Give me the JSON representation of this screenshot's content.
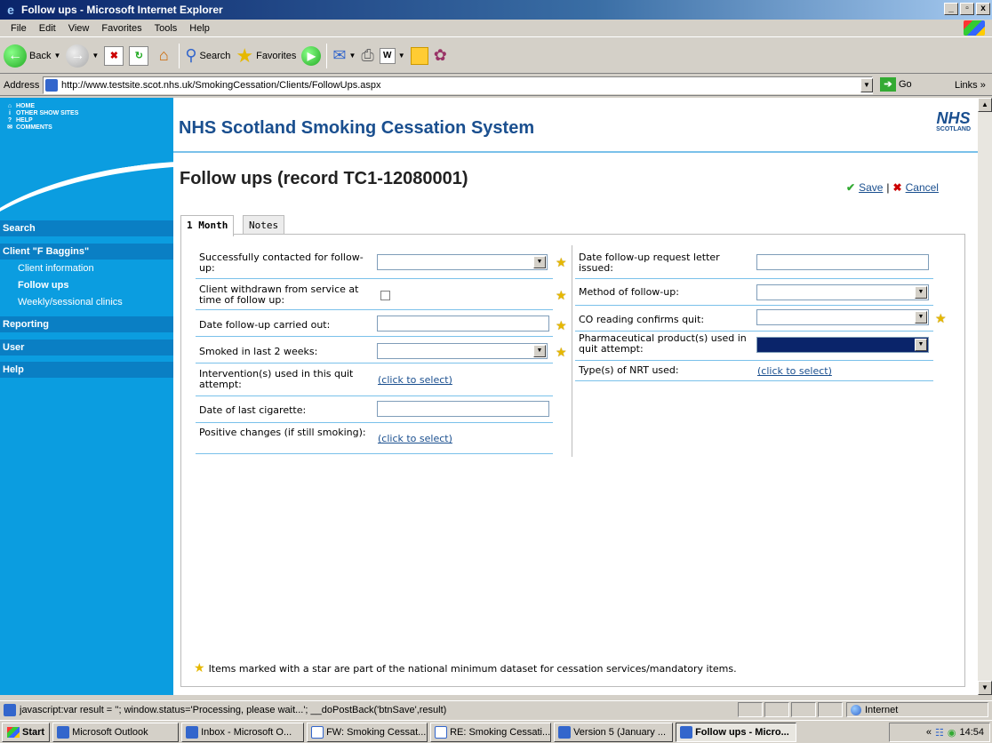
{
  "window": {
    "title": "Follow ups - Microsoft Internet Explorer",
    "min": "_",
    "max": "▫",
    "close": "x"
  },
  "menu": [
    "File",
    "Edit",
    "View",
    "Favorites",
    "Tools",
    "Help"
  ],
  "toolbar": {
    "back": "Back",
    "search": "Search",
    "favorites": "Favorites"
  },
  "address": {
    "label": "Address",
    "url": "http://www.testsite.scot.nhs.uk/SmokingCessation/Clients/FollowUps.aspx",
    "go": "Go",
    "links": "Links"
  },
  "topnav": [
    "HOME",
    "OTHER SHOW SITES",
    "HELP",
    "COMMENTS"
  ],
  "leftnav": {
    "search": "Search",
    "client": "Client \"F Baggins\"",
    "client_info": "Client information",
    "follow_ups": "Follow ups",
    "weekly": "Weekly/sessional clinics",
    "reporting": "Reporting",
    "user": "User",
    "help": "Help"
  },
  "header": {
    "title": "NHS Scotland Smoking Cessation System",
    "logo_big": "NHS",
    "logo_small": "SCOTLAND"
  },
  "page": {
    "title": "Follow ups (record TC1-12080001)",
    "save": "Save",
    "cancel": "Cancel",
    "sep": "|"
  },
  "tabs": [
    "1 Month",
    "Notes"
  ],
  "left_fields": {
    "contacted": "Successfully contacted for follow-up:",
    "withdrawn": "Client withdrawn from service at time of follow up:",
    "date_carried": "Date follow-up carried out:",
    "smoked": "Smoked in last 2 weeks:",
    "interventions": "Intervention(s) used in this quit attempt:",
    "last_cig": "Date of last cigarette:",
    "positive": "Positive changes (if still smoking):",
    "click_select": "(click to select)"
  },
  "right_fields": {
    "letter": "Date follow-up request letter issued:",
    "method": "Method of follow-up:",
    "co_reading": "CO reading confirms quit:",
    "pharma": "Pharmaceutical product(s) used in quit attempt:",
    "nrt": "Type(s) of NRT used:",
    "click_select": "(click to select)"
  },
  "footnote": "Items marked with a star are part of the national minimum dataset for cessation services/mandatory items.",
  "status": {
    "text": "javascript:var result = ''; window.status='Processing, please wait...'; __doPostBack('btnSave',result)",
    "zone": "Internet"
  },
  "taskbar": {
    "start": "Start",
    "items": [
      "Microsoft Outlook",
      "Inbox - Microsoft O...",
      "FW: Smoking Cessat...",
      "RE: Smoking Cessati...",
      "Version 5 (January ...",
      "Follow ups - Micro..."
    ],
    "time": "14:54"
  }
}
